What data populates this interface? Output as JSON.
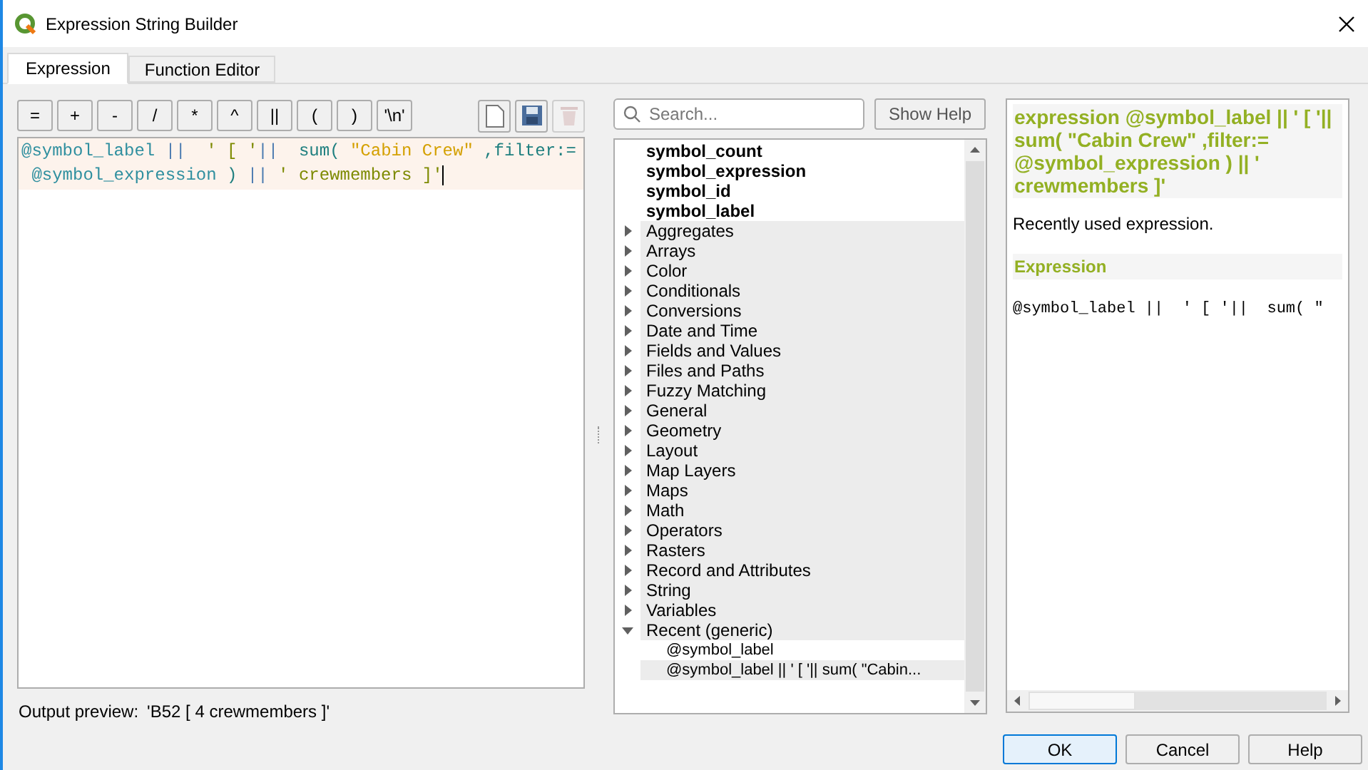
{
  "window": {
    "title": "Expression String Builder"
  },
  "tabs": [
    {
      "label": "Expression",
      "selected": true
    },
    {
      "label": "Function Editor",
      "selected": false
    }
  ],
  "operators": [
    "=",
    "+",
    "-",
    "/",
    "*",
    "^",
    "||",
    "(",
    ")",
    "'\\n'"
  ],
  "file_actions": [
    {
      "kind": "new",
      "disabled": false
    },
    {
      "kind": "save",
      "disabled": false
    },
    {
      "kind": "delete",
      "disabled": true
    }
  ],
  "editor": {
    "lines": [
      [
        {
          "kind": "variable",
          "text": "@symbol_label"
        },
        {
          "kind": "operator",
          "text": " ||"
        },
        {
          "kind": "string",
          "text": "  ' [ '"
        },
        {
          "kind": "operator",
          "text": "||"
        },
        {
          "kind": "function",
          "text": "  sum("
        },
        {
          "kind": "field",
          "text": " \"Cabin Crew\""
        },
        {
          "kind": "function",
          "text": " ,filter:="
        }
      ],
      [
        {
          "kind": "variable",
          "text": " @symbol_expression"
        },
        {
          "kind": "function",
          "text": " )"
        },
        {
          "kind": "operator",
          "text": " ||"
        },
        {
          "kind": "string",
          "text": " ' crewmembers ]'"
        }
      ]
    ]
  },
  "output_preview": {
    "label": "Output preview:",
    "value": "'B52 [ 4 crewmembers ]'"
  },
  "search": {
    "placeholder": "Search..."
  },
  "show_help_button": "Show Help",
  "tree": [
    {
      "kind": "field",
      "label": "symbol_count"
    },
    {
      "kind": "field",
      "label": "symbol_expression"
    },
    {
      "kind": "field",
      "label": "symbol_id"
    },
    {
      "kind": "field",
      "label": "symbol_label"
    },
    {
      "kind": "group",
      "label": "Aggregates",
      "expanded": false
    },
    {
      "kind": "group",
      "label": "Arrays",
      "expanded": false
    },
    {
      "kind": "group",
      "label": "Color",
      "expanded": false
    },
    {
      "kind": "group",
      "label": "Conditionals",
      "expanded": false
    },
    {
      "kind": "group",
      "label": "Conversions",
      "expanded": false
    },
    {
      "kind": "group",
      "label": "Date and Time",
      "expanded": false
    },
    {
      "kind": "group",
      "label": "Fields and Values",
      "expanded": false
    },
    {
      "kind": "group",
      "label": "Files and Paths",
      "expanded": false
    },
    {
      "kind": "group",
      "label": "Fuzzy Matching",
      "expanded": false
    },
    {
      "kind": "group",
      "label": "General",
      "expanded": false
    },
    {
      "kind": "group",
      "label": "Geometry",
      "expanded": false
    },
    {
      "kind": "group",
      "label": "Layout",
      "expanded": false
    },
    {
      "kind": "group",
      "label": "Map Layers",
      "expanded": false
    },
    {
      "kind": "group",
      "label": "Maps",
      "expanded": false
    },
    {
      "kind": "group",
      "label": "Math",
      "expanded": false
    },
    {
      "kind": "group",
      "label": "Operators",
      "expanded": false
    },
    {
      "kind": "group",
      "label": "Rasters",
      "expanded": false
    },
    {
      "kind": "group",
      "label": "Record and Attributes",
      "expanded": false
    },
    {
      "kind": "group",
      "label": "String",
      "expanded": false
    },
    {
      "kind": "group",
      "label": "Variables",
      "expanded": false
    },
    {
      "kind": "group",
      "label": "Recent (generic)",
      "expanded": true,
      "children": [
        {
          "label": "@symbol_label",
          "selected": false
        },
        {
          "label": "@symbol_label || ' [ '|| sum( \"Cabin...",
          "selected": true
        }
      ]
    }
  ],
  "help": {
    "title": "expression @symbol_label || ' [ '|| sum( \"Cabin Crew\" ,filter:= @symbol_expression ) || ' crewmembers ]'",
    "description": "Recently used expression.",
    "section": "Expression",
    "code": "@symbol_label ||  ' [ '||  sum( \""
  },
  "buttons": [
    {
      "label": "OK",
      "selected": true
    },
    {
      "label": "Cancel",
      "selected": false
    },
    {
      "label": "Help",
      "selected": false
    }
  ]
}
